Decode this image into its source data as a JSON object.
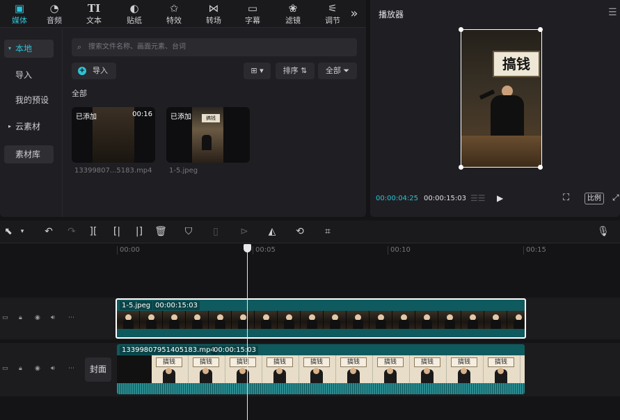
{
  "tabs": [
    {
      "label": "媒体",
      "icon": "media-icon"
    },
    {
      "label": "音频",
      "icon": "audio-icon"
    },
    {
      "label": "文本",
      "icon": "text-icon"
    },
    {
      "label": "贴纸",
      "icon": "sticker-icon"
    },
    {
      "label": "特效",
      "icon": "effects-icon"
    },
    {
      "label": "转场",
      "icon": "transition-icon"
    },
    {
      "label": "字幕",
      "icon": "subtitle-icon"
    },
    {
      "label": "滤镜",
      "icon": "filter-icon"
    },
    {
      "label": "调节",
      "icon": "adjust-icon"
    }
  ],
  "nav": {
    "local": "本地",
    "import": "导入",
    "my_presets": "我的预设",
    "cloud": "云素材",
    "library": "素材库"
  },
  "search": {
    "placeholder": "搜索文件名称、画面元素、台词"
  },
  "toolbar_top": {
    "import": "导入",
    "sort": "排序",
    "all": "全部",
    "section_all": "全部"
  },
  "media_items": [
    {
      "added": "已添加",
      "duration": "00:16",
      "name": "13399807...5183.mp4"
    },
    {
      "added": "已添加",
      "duration": "",
      "name": "1-5.jpeg"
    }
  ],
  "player": {
    "title": "播放器",
    "current_time": "00:00:04:25",
    "total_time": "00:00:15:03",
    "ratio": "比例",
    "preview_sign": "搞钱"
  },
  "ruler": [
    "00:00",
    "00:05",
    "00:10",
    "00:15"
  ],
  "tracks": [
    {
      "name": "1-5.jpeg",
      "duration": "00:00:15:03"
    },
    {
      "name": "13399807951405183.mp4",
      "duration": "00:00:15:03",
      "frame_sign": "搞钱"
    }
  ],
  "cover": "封面",
  "colors": {
    "accent": "#2cc3d6",
    "clip": "#0f5a5e",
    "background": "#141416"
  }
}
